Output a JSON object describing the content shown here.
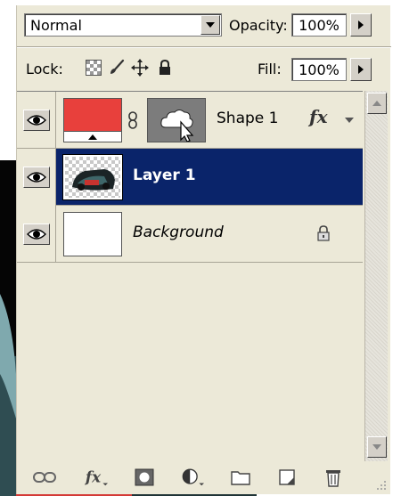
{
  "blend_mode": {
    "value": "Normal"
  },
  "opacity": {
    "label": "Opacity:",
    "value": "100%"
  },
  "lock": {
    "label": "Lock:"
  },
  "fill": {
    "label": "Fill:",
    "value": "100%"
  },
  "layers": [
    {
      "name": "Shape 1",
      "fx": "fx",
      "selected": false
    },
    {
      "name": "Layer 1",
      "selected": true
    },
    {
      "name": "Background",
      "locked": true,
      "selected": false
    }
  ],
  "bottom_tools": [
    "link-layers",
    "add-layer-style",
    "add-mask",
    "new-adjustment-layer",
    "new-group",
    "new-layer",
    "delete-layer"
  ],
  "colors": {
    "panel_bg": "#ece9d8",
    "selected_row": "#0a246a",
    "shape_fill": "#e8403c",
    "mask_fill": "#7c7c7c"
  }
}
